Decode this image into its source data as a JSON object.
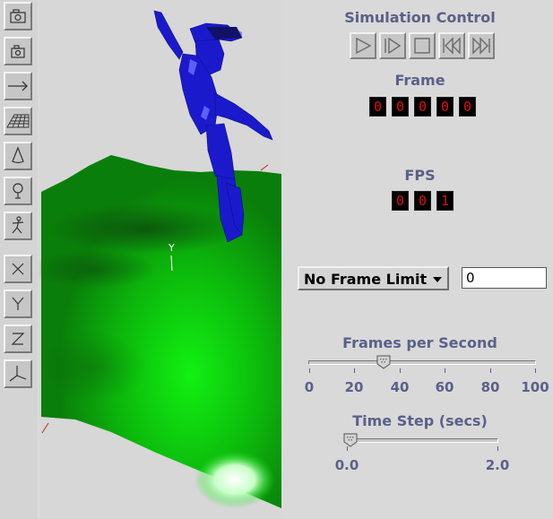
{
  "toolbar": {
    "buttons": [
      {
        "name": "camera-icon"
      },
      {
        "name": "camera-small-icon"
      },
      {
        "name": "arrow-right-icon"
      },
      {
        "name": "grid-plane-icon"
      },
      {
        "name": "cone-icon"
      },
      {
        "name": "lightbulb-icon"
      },
      {
        "name": "figure-icon"
      },
      {
        "name": "x-axis-icon"
      },
      {
        "name": "y-axis-icon"
      },
      {
        "name": "z-axis-icon"
      },
      {
        "name": "axes-icon"
      }
    ]
  },
  "viewport": {
    "axis_label": "Y",
    "colors": {
      "terrain_dark": "#0d5a0d",
      "terrain_bright": "#10e010",
      "figure": "#1a1acc"
    }
  },
  "panel": {
    "title": "Simulation Control",
    "playback_buttons": [
      "play-icon",
      "step-icon",
      "stop-icon",
      "rewind-icon",
      "fast-forward-icon"
    ],
    "frame_label": "Frame",
    "frame_digits": [
      "0",
      "0",
      "0",
      "0",
      "0"
    ],
    "fps_label": "FPS",
    "fps_digits": [
      "0",
      "0",
      "1"
    ],
    "frame_limit": {
      "selected": "No Frame Limit",
      "value": "0"
    },
    "fps_slider": {
      "label": "Frames per Second",
      "ticks": [
        "0",
        "20",
        "40",
        "60",
        "80",
        "100"
      ],
      "value": 33
    },
    "timestep_slider": {
      "label": "Time Step (secs)",
      "ticks": [
        "0.0",
        "2.0"
      ],
      "value": 0.05
    },
    "colors": {
      "label_text": "#5a6089",
      "digit_text": "#e01010"
    }
  }
}
